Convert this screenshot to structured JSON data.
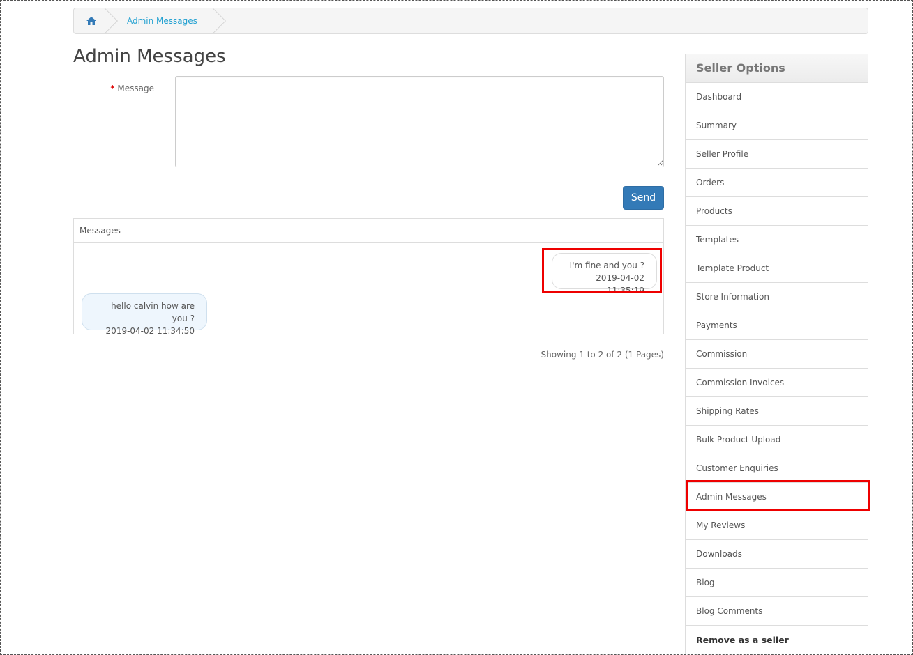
{
  "breadcrumb": {
    "home_icon": "home-icon",
    "current": "Admin Messages"
  },
  "page": {
    "title": "Admin Messages"
  },
  "form": {
    "required_mark": "*",
    "message_label": "Message",
    "message_value": "",
    "send_label": "Send"
  },
  "messages": {
    "heading": "Messages",
    "items": [
      {
        "text": "I'm fine and you ?",
        "time": "2019-04-02 11:35:19",
        "side": "right"
      },
      {
        "text": "hello calvin how are you ?",
        "time": "2019-04-02 11:34:50",
        "side": "left"
      }
    ],
    "pagination": "Showing 1 to 2 of 2 (1 Pages)"
  },
  "sidebar": {
    "title": "Seller Options",
    "items": [
      {
        "label": "Dashboard"
      },
      {
        "label": "Summary"
      },
      {
        "label": "Seller Profile"
      },
      {
        "label": "Orders"
      },
      {
        "label": "Products"
      },
      {
        "label": "Templates"
      },
      {
        "label": "Template Product"
      },
      {
        "label": "Store Information"
      },
      {
        "label": "Payments"
      },
      {
        "label": "Commission"
      },
      {
        "label": "Commission Invoices"
      },
      {
        "label": "Shipping Rates"
      },
      {
        "label": "Bulk Product Upload"
      },
      {
        "label": "Customer Enquiries"
      },
      {
        "label": "Admin Messages"
      },
      {
        "label": "My Reviews"
      },
      {
        "label": "Downloads"
      },
      {
        "label": "Blog"
      },
      {
        "label": "Blog Comments"
      },
      {
        "label": "Remove as a seller"
      }
    ]
  },
  "colors": {
    "primary": "#337ab7",
    "link": "#23a1d1",
    "highlight": "#ee0000"
  }
}
